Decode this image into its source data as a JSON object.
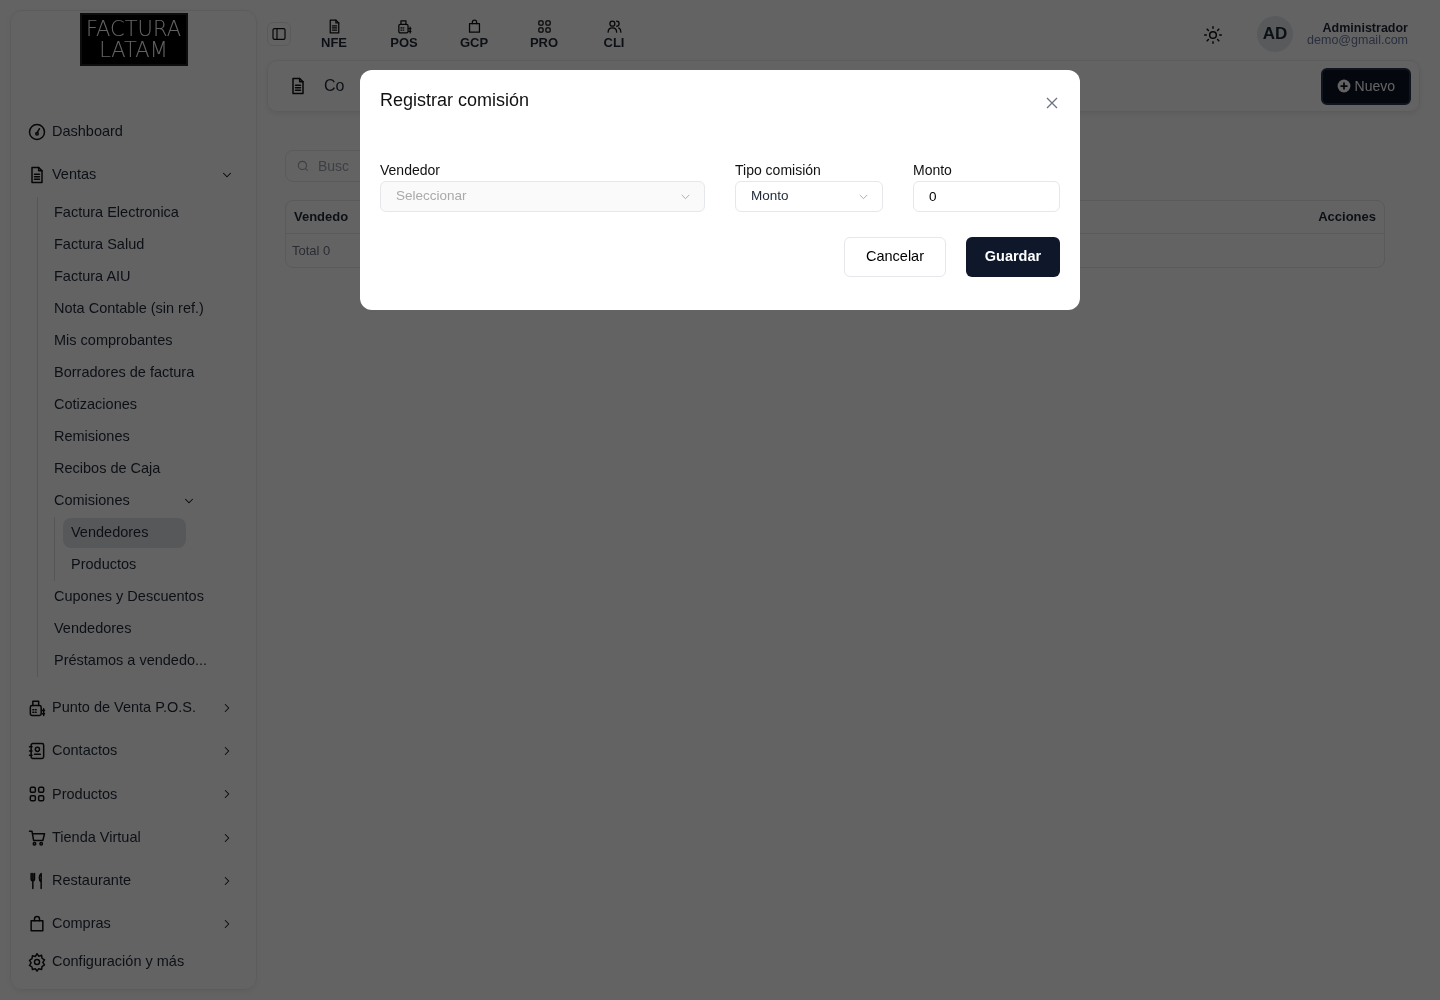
{
  "logo": {
    "line_1": "FACTURA",
    "line_2": "LATAM"
  },
  "sidebar": {
    "items": [
      {
        "kind": "link",
        "label": "Dashboard",
        "selected": false
      },
      {
        "kind": "group",
        "label": "Ventas",
        "expanded": true,
        "children": [
          {
            "label": "Factura Electronica",
            "selected": false
          },
          {
            "label": "Factura Salud",
            "selected": false
          },
          {
            "label": "Factura AIU",
            "selected": false
          },
          {
            "label": "Nota Contable (sin ref.)",
            "selected": false
          },
          {
            "label": "Mis comprobantes",
            "selected": false
          },
          {
            "label": "Borradores de factura",
            "selected": false
          },
          {
            "label": "Cotizaciones",
            "selected": false
          },
          {
            "label": "Remisiones",
            "selected": false
          },
          {
            "label": "Recibos de Caja",
            "selected": false
          },
          {
            "label": "Comisiones",
            "expanded": true,
            "children": [
              {
                "label": "Vendedores",
                "selected": true
              },
              {
                "label": "Productos",
                "selected": false
              }
            ]
          },
          {
            "label": "Cupones y Descuentos",
            "selected": false
          },
          {
            "label": "Vendedores",
            "selected": false
          },
          {
            "label": "Préstamos a vendedo...",
            "selected": false
          }
        ]
      },
      {
        "kind": "group",
        "label": "Punto de Venta P.O.S.",
        "expanded": false
      },
      {
        "kind": "group",
        "label": "Contactos",
        "expanded": false
      },
      {
        "kind": "group",
        "label": "Productos",
        "expanded": false
      },
      {
        "kind": "group",
        "label": "Tienda Virtual",
        "expanded": false
      },
      {
        "kind": "group",
        "label": "Restaurante",
        "expanded": false
      },
      {
        "kind": "group",
        "label": "Compras",
        "expanded": false
      },
      {
        "kind": "link",
        "label": "Configuración y más",
        "selected": false
      }
    ]
  },
  "topbar": {
    "shortcuts": [
      {
        "label": "NFE"
      },
      {
        "label": "POS"
      },
      {
        "label": "GCP"
      },
      {
        "label": "PRO"
      },
      {
        "label": "CLI"
      }
    ],
    "user": {
      "initials": "AD",
      "name": "Administrador",
      "email": "demo@gmail.com"
    }
  },
  "page": {
    "title": "Co",
    "new_button": "Nuevo",
    "search": {
      "placeholder": "Busc"
    },
    "table": {
      "columns": [
        "Vendedo",
        "Acciones"
      ],
      "footer": "Total 0"
    }
  },
  "modal": {
    "title": "Registrar comisión",
    "fields": [
      {
        "kind": "select",
        "label": "Vendedor",
        "placeholder": "Seleccionar"
      },
      {
        "kind": "select",
        "label": "Tipo comisión",
        "value": "Monto"
      },
      {
        "kind": "input",
        "label": "Monto",
        "value": "0"
      }
    ],
    "buttons": [
      {
        "kind": "secondary",
        "label": "Cancelar"
      },
      {
        "kind": "primary",
        "label": "Guardar"
      }
    ]
  }
}
